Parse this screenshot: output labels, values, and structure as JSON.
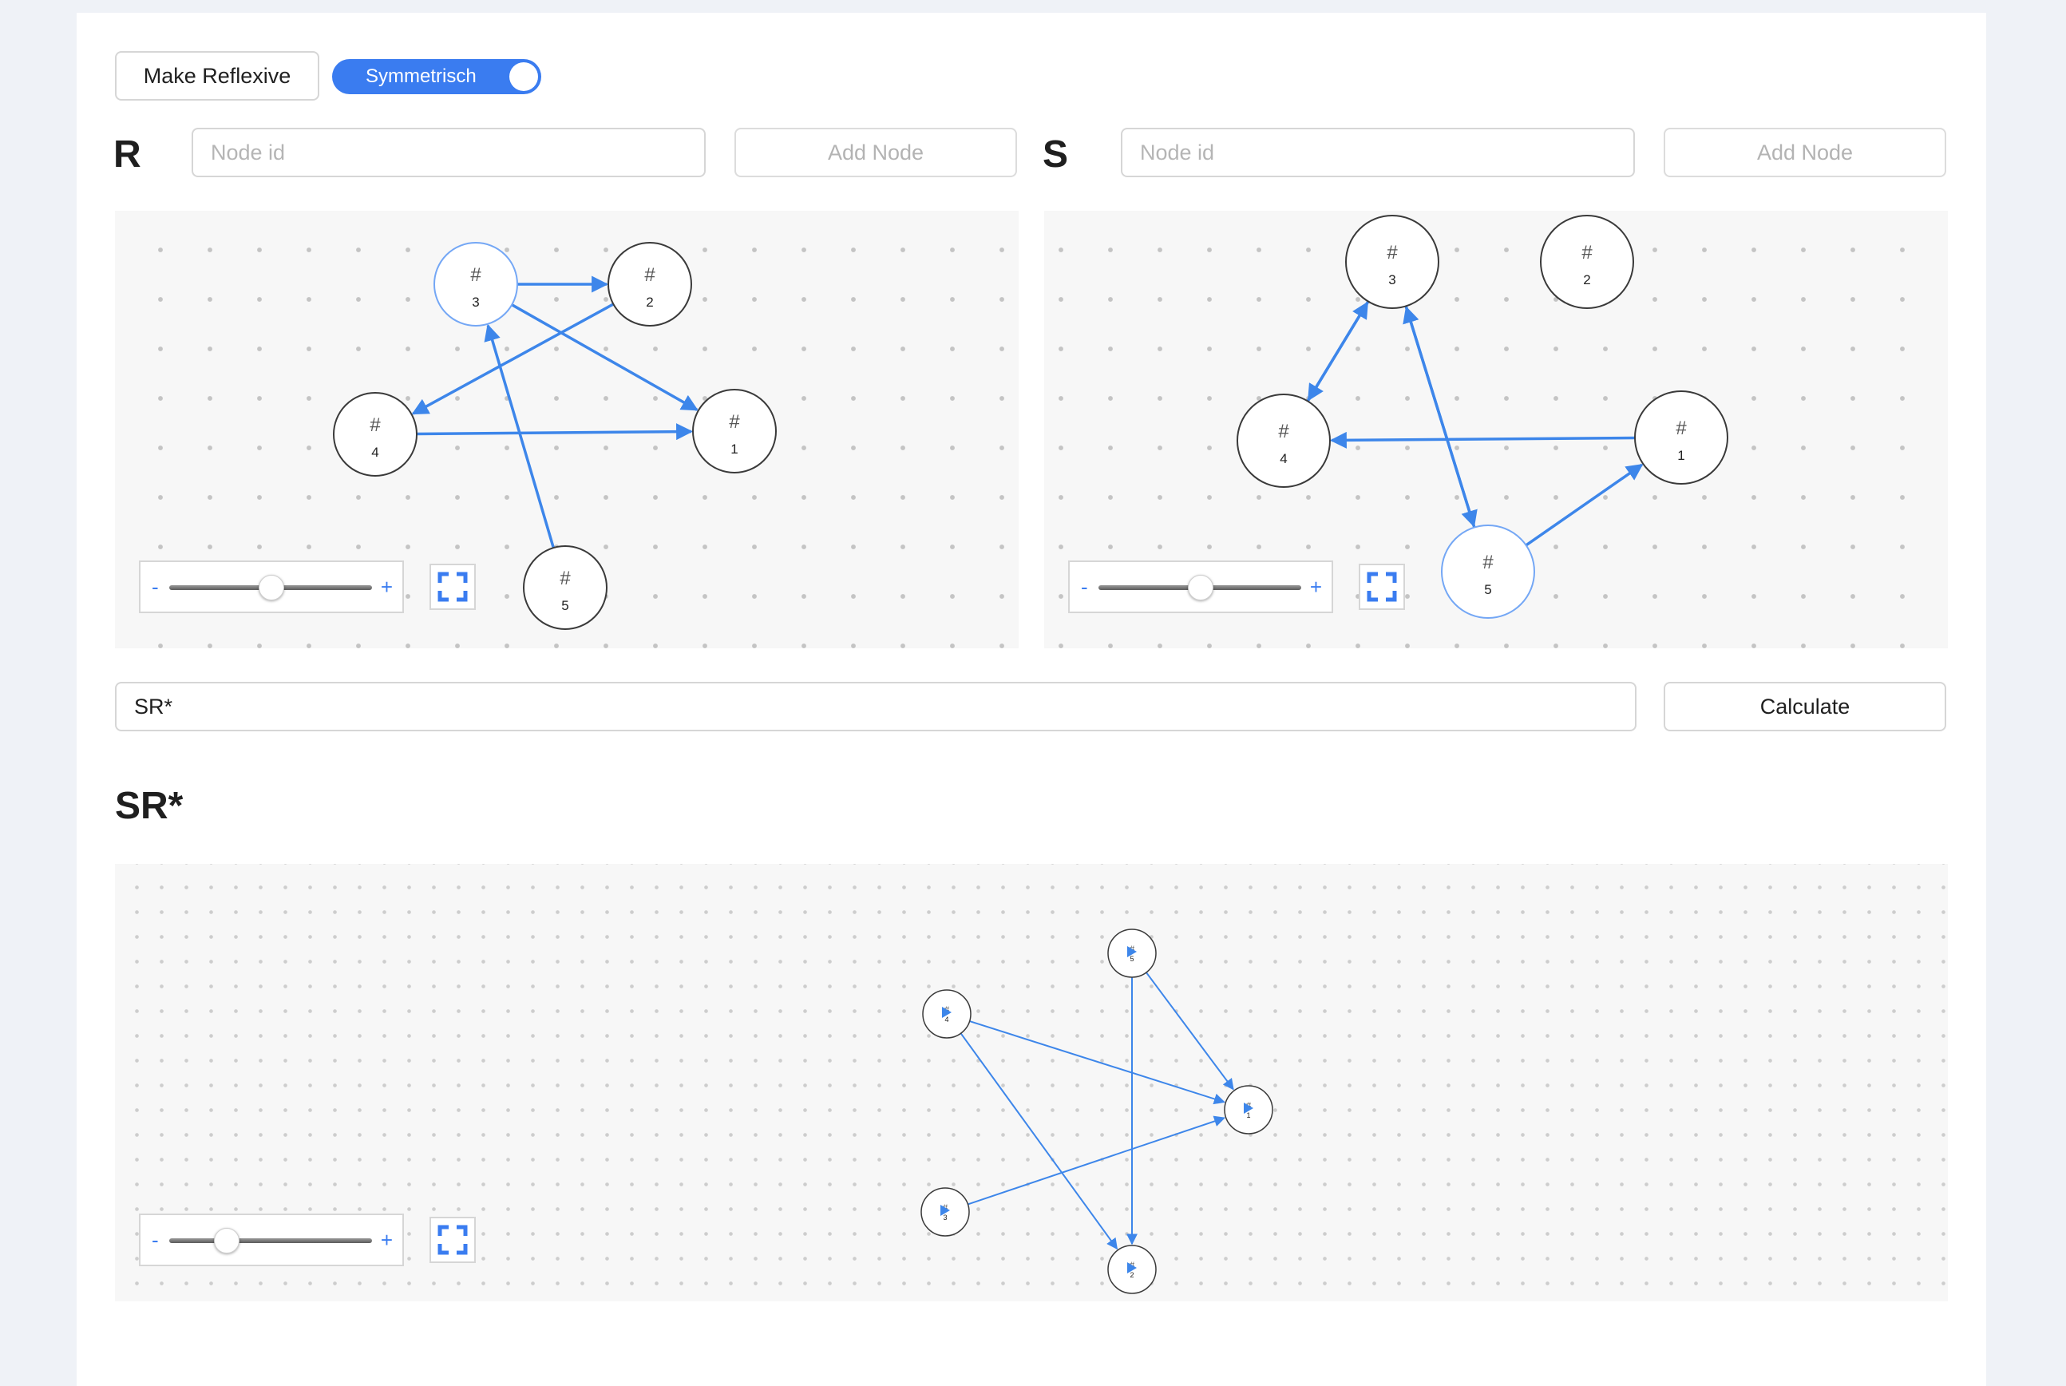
{
  "toolbar": {
    "make_reflexive_label": "Make Reflexive",
    "symmetric_toggle_label": "Symmetrisch",
    "symmetric_on": true
  },
  "relation_r": {
    "letter": "R",
    "node_input_placeholder": "Node id",
    "add_node_label": "Add Node",
    "zoom_level": 0.5,
    "nodes": [
      {
        "id": "3",
        "label": "#",
        "highlighted": true
      },
      {
        "id": "2",
        "label": "#",
        "highlighted": false
      },
      {
        "id": "4",
        "label": "#",
        "highlighted": false
      },
      {
        "id": "1",
        "label": "#",
        "highlighted": false
      },
      {
        "id": "5",
        "label": "#",
        "highlighted": false
      }
    ],
    "edges": [
      [
        "3",
        "2"
      ],
      [
        "2",
        "4"
      ],
      [
        "3",
        "1"
      ],
      [
        "4",
        "1"
      ],
      [
        "5",
        "3"
      ]
    ]
  },
  "relation_s": {
    "letter": "S",
    "node_input_placeholder": "Node id",
    "add_node_label": "Add Node",
    "zoom_level": 0.5,
    "nodes": [
      {
        "id": "3",
        "label": "#",
        "highlighted": false
      },
      {
        "id": "2",
        "label": "#",
        "highlighted": false
      },
      {
        "id": "4",
        "label": "#",
        "highlighted": false
      },
      {
        "id": "1",
        "label": "#",
        "highlighted": false
      },
      {
        "id": "5",
        "label": "#",
        "highlighted": true
      }
    ],
    "edges": [
      [
        "3",
        "4"
      ],
      [
        "4",
        "3"
      ],
      [
        "3",
        "5"
      ],
      [
        "5",
        "3"
      ],
      [
        "1",
        "4"
      ],
      [
        "5",
        "1"
      ]
    ]
  },
  "expression": {
    "value": "SR*",
    "calculate_label": "Calculate"
  },
  "result": {
    "title": "SR*",
    "zoom_level": 0.28,
    "nodes": [
      {
        "id": "5",
        "label": "#"
      },
      {
        "id": "4",
        "label": "#"
      },
      {
        "id": "1",
        "label": "#"
      },
      {
        "id": "3",
        "label": "#"
      },
      {
        "id": "2",
        "label": "#"
      }
    ],
    "edges": [
      [
        "5",
        "1"
      ],
      [
        "5",
        "2"
      ],
      [
        "4",
        "1"
      ],
      [
        "4",
        "2"
      ],
      [
        "3",
        "1"
      ]
    ]
  },
  "colors": {
    "accent": "#3a7cf0",
    "edge": "#3d86ea",
    "node_border": "#3a3a3a",
    "highlight_border": "#74a7f5"
  },
  "icons": {
    "zoom_minus": "minus-icon",
    "zoom_plus": "plus-icon",
    "fit": "fullscreen-icon"
  },
  "zoom_controls": {
    "minus": "-",
    "plus": "+"
  }
}
